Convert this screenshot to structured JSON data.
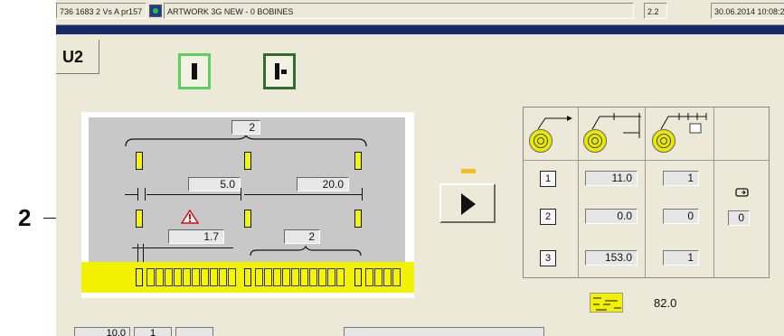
{
  "callout": {
    "label": "2"
  },
  "titlebar": {
    "session": "736 1683 2 Vs A pr157",
    "app_title": "ARTWORK 3G NEW - 0 BOBINES",
    "version": "2.2",
    "datetime": "30.06.2014 10:08:20"
  },
  "unit": {
    "label": "U2"
  },
  "modes": [
    {
      "name": "mode-run-button",
      "active": true
    },
    {
      "name": "mode-step-button",
      "active": false
    }
  ],
  "diagram": {
    "count_top": "2",
    "spacing_left": "5.0",
    "spacing_right": "20.0",
    "offset": "1.7",
    "count_bottom": "2",
    "warning_icon": "warning-triangle-icon"
  },
  "table": {
    "header_icons": [
      "coil-feed-icon",
      "coil-spacing-icon",
      "coil-count-icon"
    ],
    "rows": [
      {
        "index": "1",
        "length": "11.0",
        "count": "1"
      },
      {
        "index": "2",
        "length": "0.0",
        "count": "0"
      },
      {
        "index": "3",
        "length": "153.0",
        "count": "1"
      }
    ],
    "side_icon": "repeat-icon",
    "side_value": "0"
  },
  "total": {
    "icon": "tape-layout-icon",
    "value": "82.0"
  },
  "footer": {
    "value_a": "10.0",
    "value_b": "1"
  },
  "colors": {
    "accent_blue": "#162a66",
    "tape_yellow": "#f2f200",
    "active_green": "#5fcf5f"
  }
}
